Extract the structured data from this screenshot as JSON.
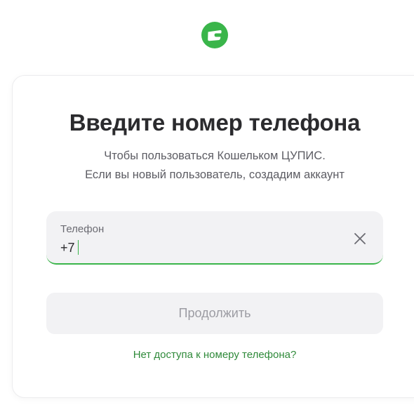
{
  "brand": {
    "logo_icon": "wallet-logo-icon",
    "accent_color": "#3ab54a"
  },
  "header": {
    "title": "Введите номер телефона",
    "subtitle_line1": "Чтобы пользоваться Кошельком ЦУПИС.",
    "subtitle_line2": "Если вы новый пользователь, создадим аккаунт"
  },
  "phone_field": {
    "label": "Телефон",
    "value": "+7",
    "clear_icon": "close-icon"
  },
  "actions": {
    "continue_label": "Продолжить",
    "no_access_link": "Нет доступа к номеру телефона?"
  }
}
